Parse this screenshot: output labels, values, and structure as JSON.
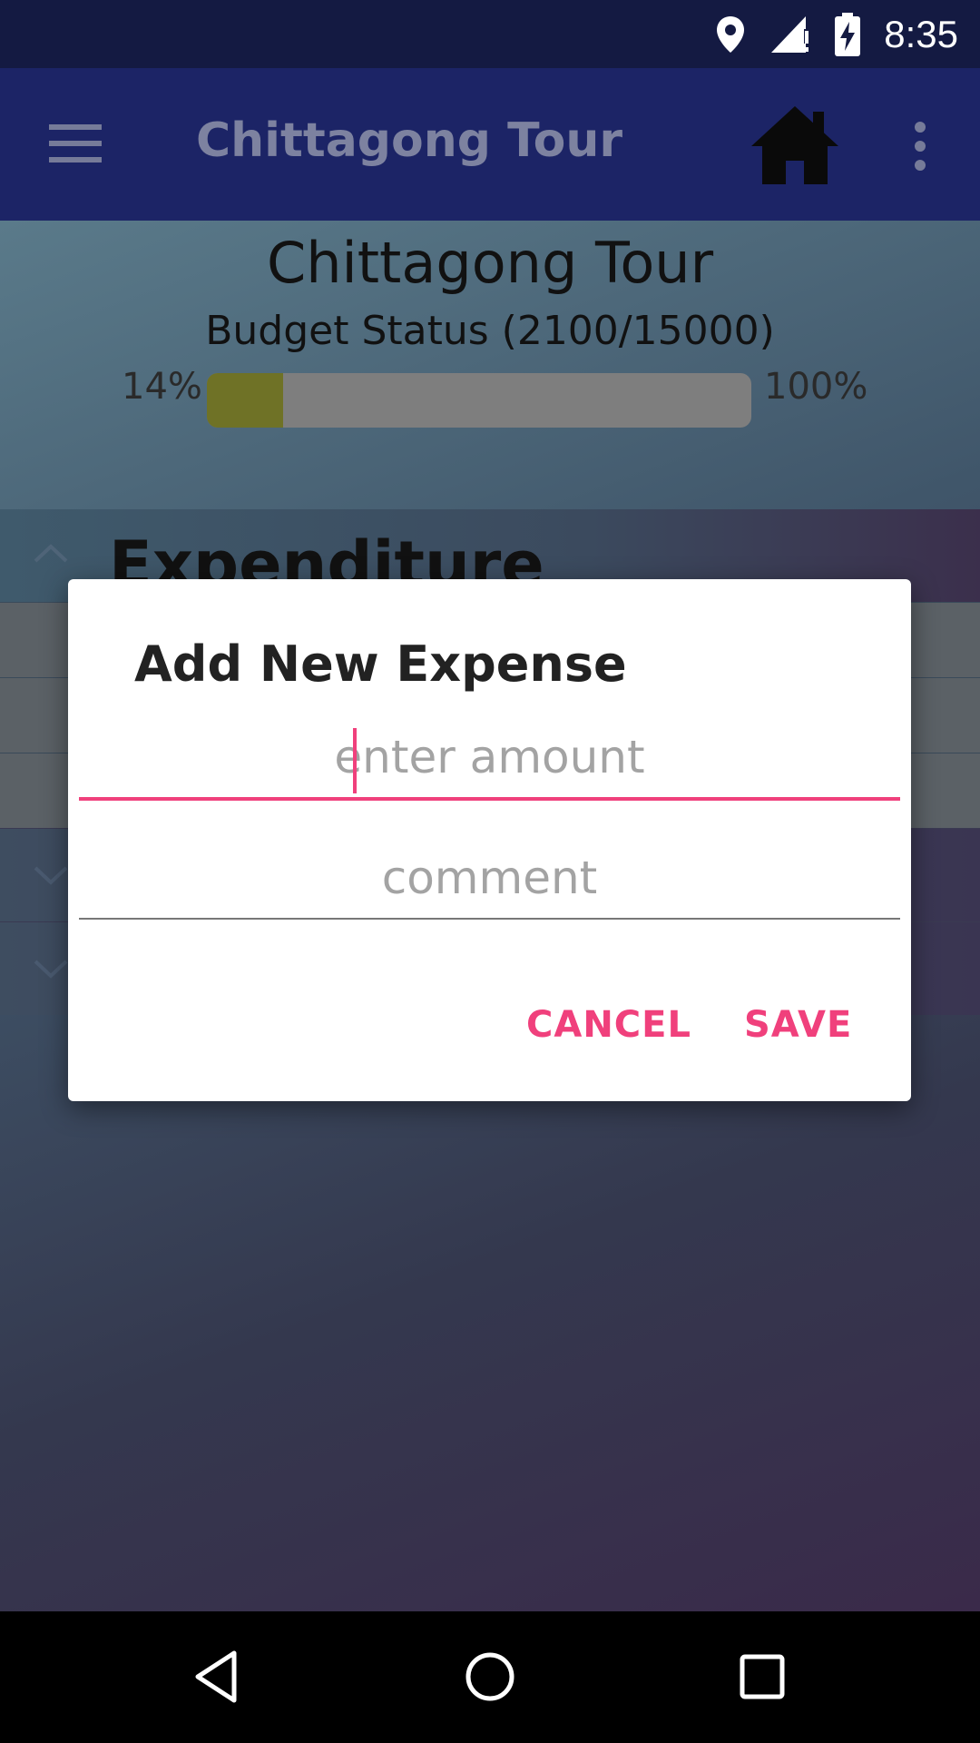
{
  "status_bar": {
    "time": "8:35",
    "icons": [
      "location-pin-icon",
      "signal-icon",
      "battery-charging-icon"
    ]
  },
  "app_bar": {
    "title": "Chittagong Tour",
    "icons": [
      "menu-icon",
      "home-icon",
      "overflow-menu-icon"
    ]
  },
  "main": {
    "tour_title": "Chittagong Tour",
    "budget_status": "Budget Status (2100/15000)",
    "progress": {
      "min_label": "14%",
      "max_label": "100%",
      "fraction": 0.14
    },
    "section_title": "Expenditure"
  },
  "dialog": {
    "title": "Add New Expense",
    "amount_placeholder": "enter amount",
    "amount_value": "",
    "comment_placeholder": "comment",
    "comment_value": "",
    "cancel_label": "CANCEL",
    "save_label": "SAVE"
  },
  "colors": {
    "accent": "#f0407c",
    "app_bar": "#1c2466",
    "status_bar": "#141a42"
  },
  "nav_bar": {
    "icons": [
      "back-icon",
      "home-circle-icon",
      "recents-icon"
    ]
  }
}
